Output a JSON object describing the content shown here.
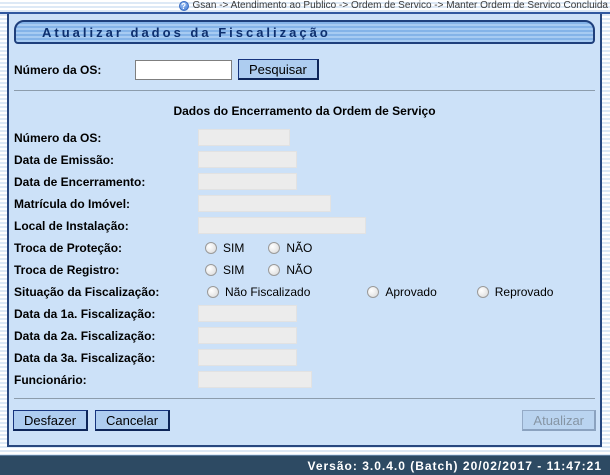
{
  "breadcrumb": {
    "icon_glyph": "?",
    "text": "Gsan -> Atendimento ao Publico -> Ordem de Servico -> Manter Ordem de Servico Concluida"
  },
  "window": {
    "title": "Atualizar dados da Fiscalização"
  },
  "search": {
    "label": "Número da OS:",
    "value": "",
    "button_label": "Pesquisar"
  },
  "section_title": "Dados do Encerramento da Ordem de Serviço",
  "fields": {
    "numero_os": {
      "label": "Número da OS:",
      "value": ""
    },
    "data_emissao": {
      "label": "Data de Emissão:",
      "value": ""
    },
    "data_encerramento": {
      "label": "Data de Encerramento:",
      "value": ""
    },
    "matricula_imovel": {
      "label": "Matrícula do Imóvel:",
      "value": ""
    },
    "local_instalacao": {
      "label": "Local de Instalação:",
      "value": ""
    },
    "data_fiscalizacao_1": {
      "label": "Data da 1a. Fiscalização:",
      "value": ""
    },
    "data_fiscalizacao_2": {
      "label": "Data da 2a. Fiscalização:",
      "value": ""
    },
    "data_fiscalizacao_3": {
      "label": "Data da 3a. Fiscalização:",
      "value": ""
    },
    "funcionario": {
      "label": "Funcionário:",
      "value": ""
    }
  },
  "radio_groups": {
    "troca_protecao": {
      "label": "Troca de Proteção:",
      "options": [
        "SIM",
        "NÃO"
      ],
      "selected": null
    },
    "troca_registro": {
      "label": "Troca de Registro:",
      "options": [
        "SIM",
        "NÃO"
      ],
      "selected": null
    },
    "situacao_fiscalizacao": {
      "label": "Situação da Fiscalização:",
      "options": [
        "Não Fiscalizado",
        "Aprovado",
        "Reprovado"
      ],
      "selected": null
    }
  },
  "buttons": {
    "desfazer": "Desfazer",
    "cancelar": "Cancelar",
    "atualizar": "Atualizar"
  },
  "statusbar": {
    "text": "Versão: 3.0.4.0 (Batch) 20/02/2017 - 11:47:21"
  },
  "colors": {
    "window_bg": "#cce1f8",
    "window_border": "#27477f",
    "titlebar_stripe": "#84b3e8",
    "title_text": "#0d2f6e",
    "button_bg": "#aecdf0",
    "readonly_bg": "#ececec",
    "footer_bg": "#2d4a63"
  }
}
